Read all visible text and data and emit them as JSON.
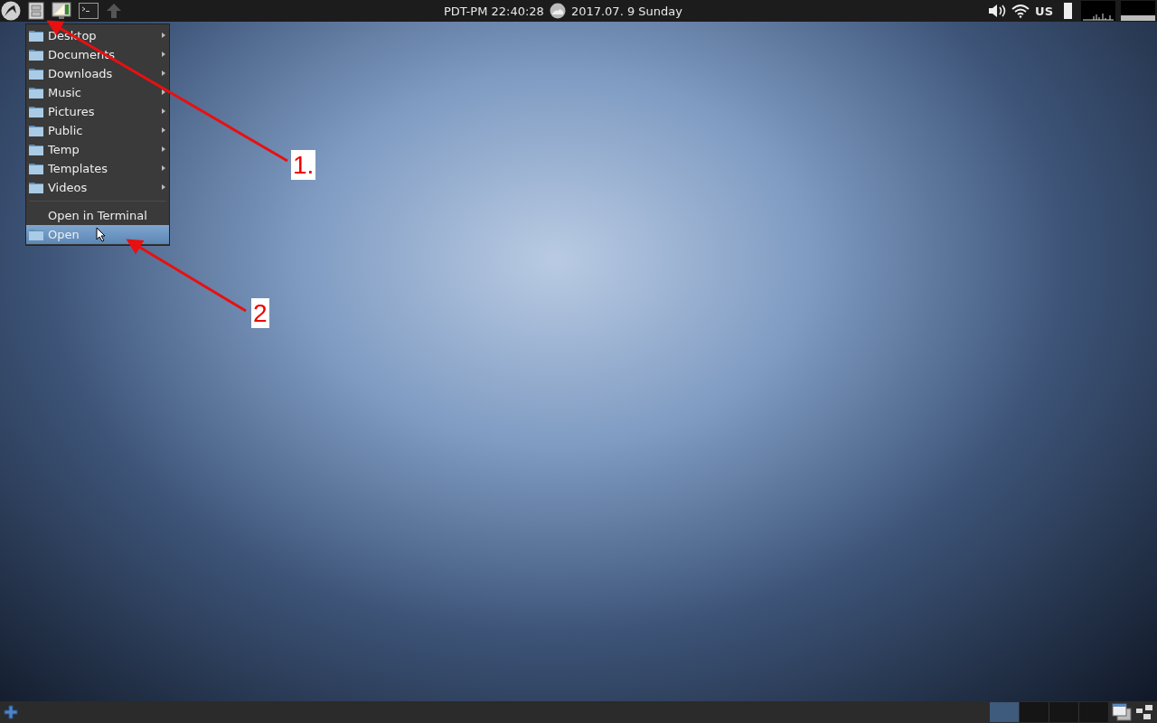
{
  "top_panel": {
    "clock": "PDT-PM 22:40:28",
    "date": "2017.07. 9 Sunday",
    "keyboard_layout": "US"
  },
  "places_menu": {
    "places": [
      {
        "label": "Desktop",
        "selected": false
      },
      {
        "label": "Documents",
        "selected": false
      },
      {
        "label": "Downloads",
        "selected": false
      },
      {
        "label": "Music",
        "selected": false
      },
      {
        "label": "Pictures",
        "selected": false
      },
      {
        "label": "Public",
        "selected": false
      },
      {
        "label": "Temp",
        "selected": false
      },
      {
        "label": "Templates",
        "selected": false
      },
      {
        "label": "Videos",
        "selected": false
      }
    ],
    "actions": [
      {
        "label": "Open in Terminal",
        "kind": "plain",
        "selected": false
      },
      {
        "label": "Open",
        "kind": "folder",
        "selected": true
      }
    ]
  },
  "annotations": [
    {
      "label": "1."
    },
    {
      "label": "2"
    }
  ],
  "bottom_panel": {
    "workspaces": [
      {
        "selected": true
      },
      {
        "selected": false
      },
      {
        "selected": false
      },
      {
        "selected": false
      }
    ]
  }
}
